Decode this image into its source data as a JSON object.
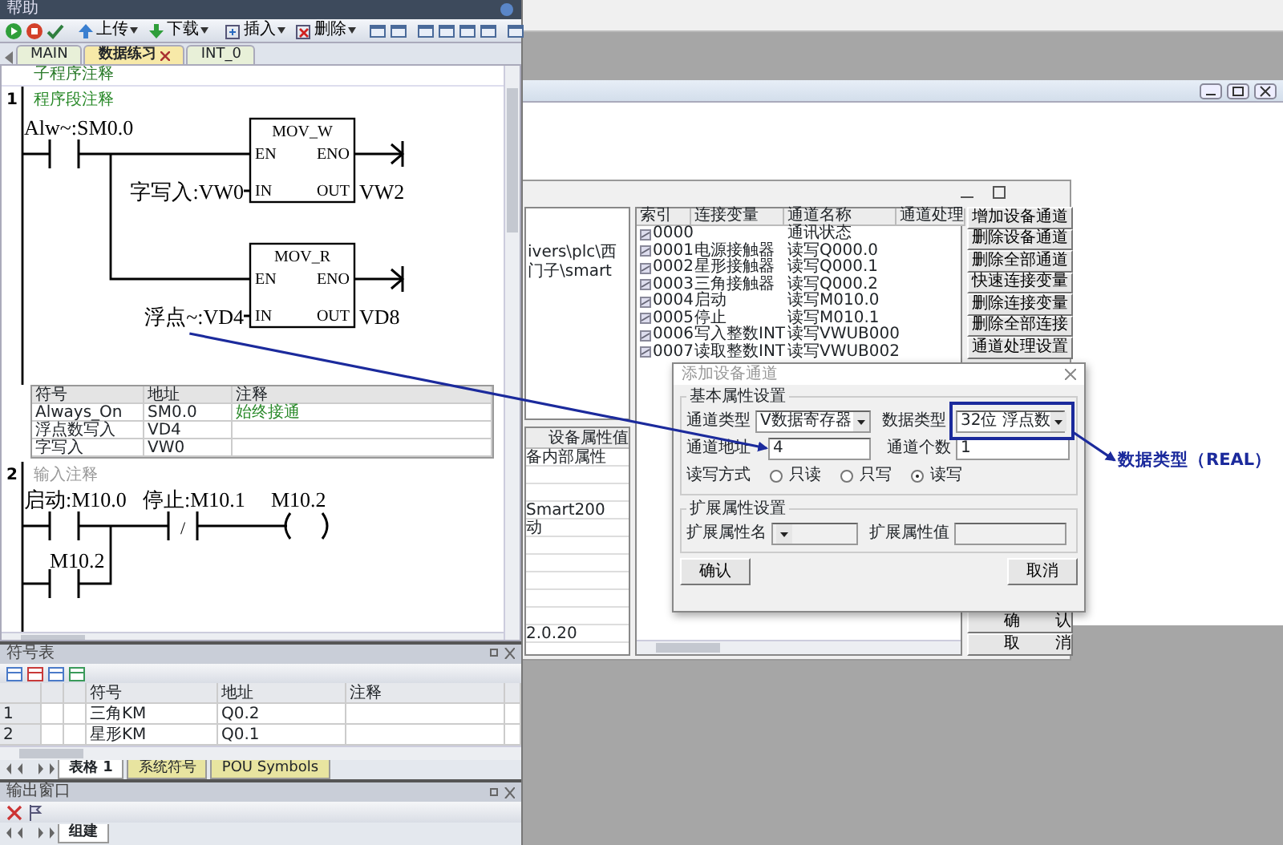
{
  "editor": {
    "title": "帮助",
    "toolbar": [
      {
        "label": "上传"
      },
      {
        "label": "下载"
      },
      {
        "label": "插入"
      },
      {
        "label": "删除"
      }
    ],
    "tabs": [
      {
        "label": "MAIN",
        "selected": false
      },
      {
        "label": "数据练习",
        "selected": true
      },
      {
        "label": "INT_0",
        "selected": false
      }
    ],
    "subroutine_comment": "子程序注释",
    "network_1": {
      "number": "1",
      "comment": "程序段注释",
      "contact": "Alw~:SM0.0",
      "boxes": [
        {
          "title": "MOV_W",
          "en": "EN",
          "eno": "ENO",
          "in": "IN",
          "out": "OUT",
          "in_operand": "字写入:VW0",
          "out_operand": "VW2"
        },
        {
          "title": "MOV_R",
          "en": "EN",
          "eno": "ENO",
          "in": "IN",
          "out": "OUT",
          "in_operand": "浮点~:VD4",
          "out_operand": "VD8"
        }
      ],
      "symbols": {
        "columns": [
          "符号",
          "地址",
          "注释"
        ],
        "rows": [
          {
            "symbol": "Always_On",
            "address": "SM0.0",
            "comment": "始终接通"
          },
          {
            "symbol": "浮点数写入",
            "address": "VD4"
          },
          {
            "symbol": "字写入",
            "address": "VW0"
          }
        ]
      }
    },
    "network_2": {
      "number": "2",
      "comment_placeholder": "输入注释",
      "contacts": [
        {
          "label": "启动:M10.0",
          "kind": "no"
        },
        {
          "label": "停止:M10.1",
          "kind": "nc",
          "mark": "/"
        }
      ],
      "coil": "M10.2",
      "parallel_contact": "M10.2"
    }
  },
  "symbol_table": {
    "title": "符号表",
    "columns": [
      "符号",
      "地址",
      "注释"
    ],
    "rows": [
      {
        "number": "1",
        "symbol": "三角KM",
        "address": "Q0.2"
      },
      {
        "number": "2",
        "symbol": "星形KM",
        "address": "Q0.1"
      }
    ],
    "sheet_tabs": [
      {
        "label": "表格 1",
        "selected": true
      },
      {
        "label": "系统符号",
        "selected": false
      },
      {
        "label": "POU Symbols",
        "selected": false
      }
    ]
  },
  "output_window": {
    "title": "输出窗口",
    "tabs": [
      {
        "label": "组建",
        "selected": true
      }
    ]
  },
  "device_window": {
    "path": "ivers\\plc\\西门子\\smart",
    "property_header": "设备属性值",
    "property_rows": [
      {
        "value": "备内部属性"
      },
      {},
      {},
      {
        "value": "Smart200"
      },
      {
        "value": "动"
      },
      {},
      {},
      {},
      {},
      {},
      {
        "value": "2.0.20"
      }
    ],
    "channel_table": {
      "columns": [
        "索引",
        "连接变量",
        "通道名称",
        "通道处理"
      ],
      "rows": [
        {
          "index": "0000",
          "name": "通讯状态"
        },
        {
          "index": "0001",
          "variable": "电源接触器",
          "name": "读写Q000.0"
        },
        {
          "index": "0002",
          "variable": "星形接触器",
          "name": "读写Q000.1"
        },
        {
          "index": "0003",
          "variable": "三角接触器",
          "name": "读写Q000.2"
        },
        {
          "index": "0004",
          "variable": "启动",
          "name": "读写M010.0"
        },
        {
          "index": "0005",
          "variable": "停止",
          "name": "读写M010.1"
        },
        {
          "index": "0006",
          "variable": "写入整数INT",
          "name": "读写VWUB000"
        },
        {
          "index": "0007",
          "variable": "读取整数INT",
          "name": "读写VWUB002"
        }
      ]
    },
    "buttons": [
      "增加设备通道",
      "删除设备通道",
      "删除全部通道",
      "快速连接变量",
      "删除连接变量",
      "删除全部连接",
      "通道处理设置"
    ],
    "bottom_buttons": [
      "确认",
      "取消"
    ]
  },
  "dialog": {
    "title": "添加设备通道",
    "basic_group": "基本属性设置",
    "channel_type": {
      "label": "通道类型",
      "value": "V数据寄存器"
    },
    "data_type": {
      "label": "数据类型",
      "value": "32位 浮点数"
    },
    "address": {
      "label": "通道地址",
      "value": "4"
    },
    "count": {
      "label": "通道个数",
      "value": "1"
    },
    "access": {
      "label": "读写方式",
      "options": [
        {
          "label": "只读",
          "selected": false
        },
        {
          "label": "只写",
          "selected": false
        },
        {
          "label": "读写",
          "selected": true
        }
      ]
    },
    "extension_group": "扩展属性设置",
    "extension_name": {
      "label": "扩展属性名"
    },
    "extension_value": {
      "label": "扩展属性值"
    },
    "buttons": [
      "确认",
      "取消"
    ]
  },
  "annotation": {
    "label": "数据类型（REAL）"
  }
}
